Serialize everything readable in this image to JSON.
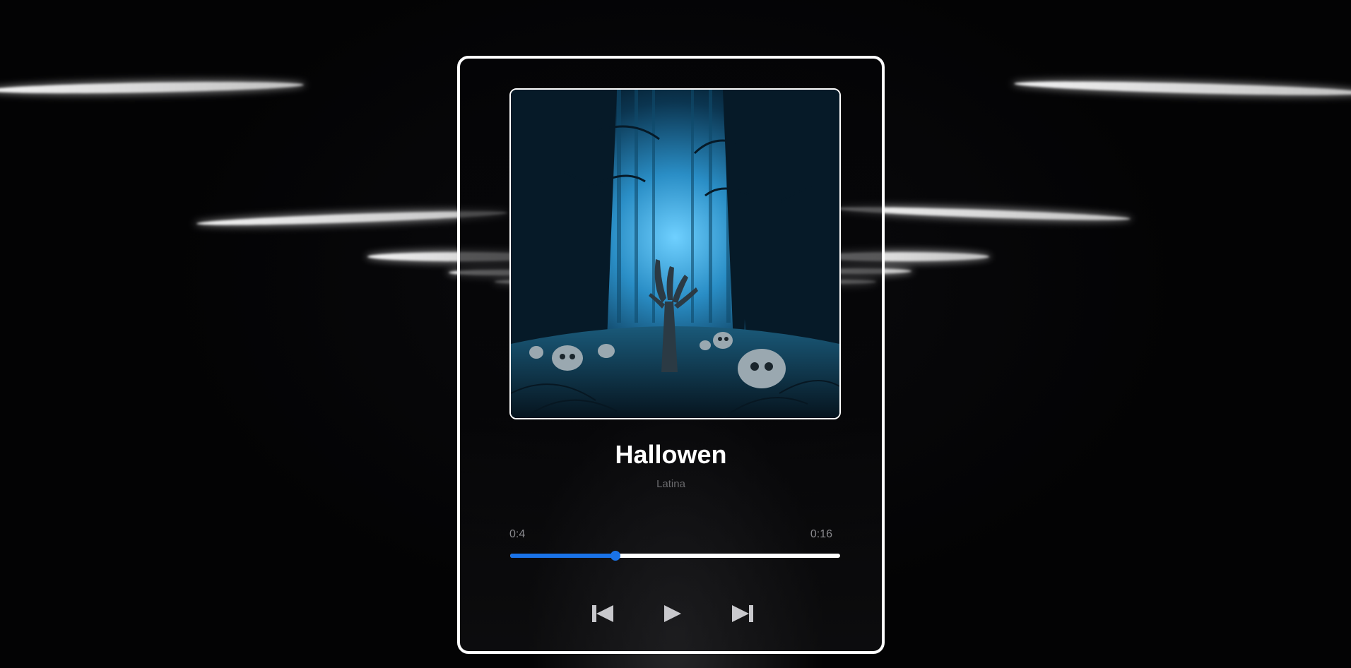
{
  "player": {
    "title": "Hallowen",
    "artist": "Latina",
    "current_time": "0:4",
    "duration": "0:16",
    "progress_fraction": 0.32,
    "accent_color": "#1a73e8",
    "cover_icon": "haunted-forest-cover",
    "controls": {
      "prev_icon": "skip-previous-icon",
      "play_icon": "play-icon",
      "next_icon": "skip-next-icon"
    }
  }
}
